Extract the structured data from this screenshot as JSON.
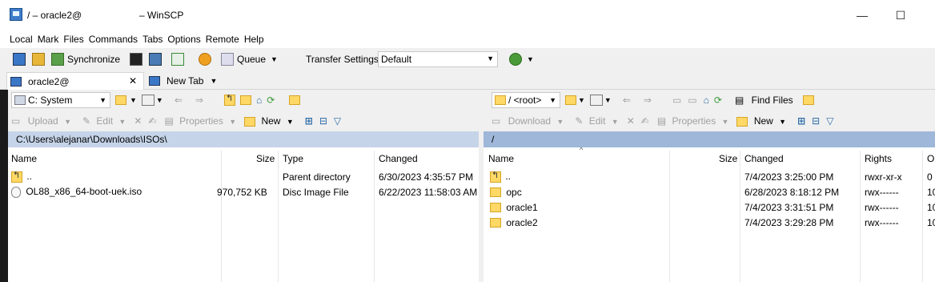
{
  "window": {
    "title_left": "/ – oracle2@",
    "title_right": "– WinSCP",
    "min": "—",
    "max": "☐",
    "close": "✕"
  },
  "menu": [
    "Local",
    "Mark",
    "Files",
    "Commands",
    "Tabs",
    "Options",
    "Remote",
    "Help"
  ],
  "toolbar": {
    "synchronize": "Synchronize",
    "queue": "Queue",
    "transfer_settings_label": "Transfer Settings",
    "transfer_settings_value": "Default"
  },
  "tabs": [
    {
      "label": "oracle2@",
      "close": "✕"
    },
    {
      "label": "New Tab"
    }
  ],
  "left": {
    "drive": "C: System",
    "upload": "Upload",
    "edit": "Edit",
    "properties": "Properties",
    "new": "New",
    "path": "C:\\Users\\alejanar\\Downloads\\ISOs\\",
    "columns": [
      "Name",
      "Size",
      "Type",
      "Changed"
    ],
    "rows": [
      {
        "name": "..",
        "size": "",
        "type": "Parent directory",
        "changed": "6/30/2023 4:35:57 PM"
      },
      {
        "name": "OL88_x86_64-boot-uek.iso",
        "size": "970,752 KB",
        "type": "Disc Image File",
        "changed": "6/22/2023 11:58:03 AM"
      }
    ]
  },
  "right": {
    "drive": "/ <root>",
    "find_files": "Find Files",
    "download": "Download",
    "edit": "Edit",
    "properties": "Properties",
    "new": "New",
    "path": "/",
    "columns": [
      "Name",
      "Size",
      "Changed",
      "Rights",
      "O"
    ],
    "rows": [
      {
        "name": "..",
        "size": "",
        "changed": "7/4/2023 3:25:00 PM",
        "rights": "rwxr-xr-x",
        "owner": "0"
      },
      {
        "name": "opc",
        "size": "",
        "changed": "6/28/2023 8:18:12 PM",
        "rights": "rwx------",
        "owner": "10"
      },
      {
        "name": "oracle1",
        "size": "",
        "changed": "7/4/2023 3:31:51 PM",
        "rights": "rwx------",
        "owner": "10"
      },
      {
        "name": "oracle2",
        "size": "",
        "changed": "7/4/2023 3:29:28 PM",
        "rights": "rwx------",
        "owner": "10"
      }
    ]
  }
}
